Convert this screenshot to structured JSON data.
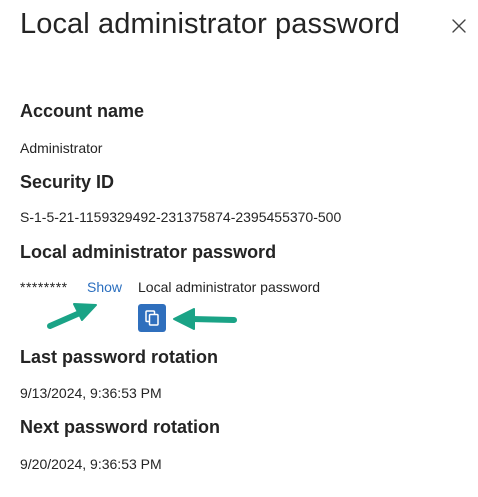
{
  "panel": {
    "title": "Local administrator password",
    "close_icon": "close-icon"
  },
  "account": {
    "heading": "Account name",
    "value": "Administrator"
  },
  "security": {
    "heading": "Security ID",
    "value": "S-1-5-21-1159329492-231375874-2395455370-500"
  },
  "password": {
    "heading": "Local administrator password",
    "masked": "********",
    "show_label": "Show",
    "label": "Local administrator password",
    "copy_icon": "copy-icon",
    "annotation_color": "#1aa386"
  },
  "last_rotation": {
    "heading": "Last password rotation",
    "value": "9/13/2024, 9:36:53 PM"
  },
  "next_rotation": {
    "heading": "Next password rotation",
    "value": "9/20/2024, 9:36:53 PM"
  },
  "colors": {
    "link": "#2b6fbf",
    "copy_button": "#2f6fbd",
    "text": "#242424"
  }
}
